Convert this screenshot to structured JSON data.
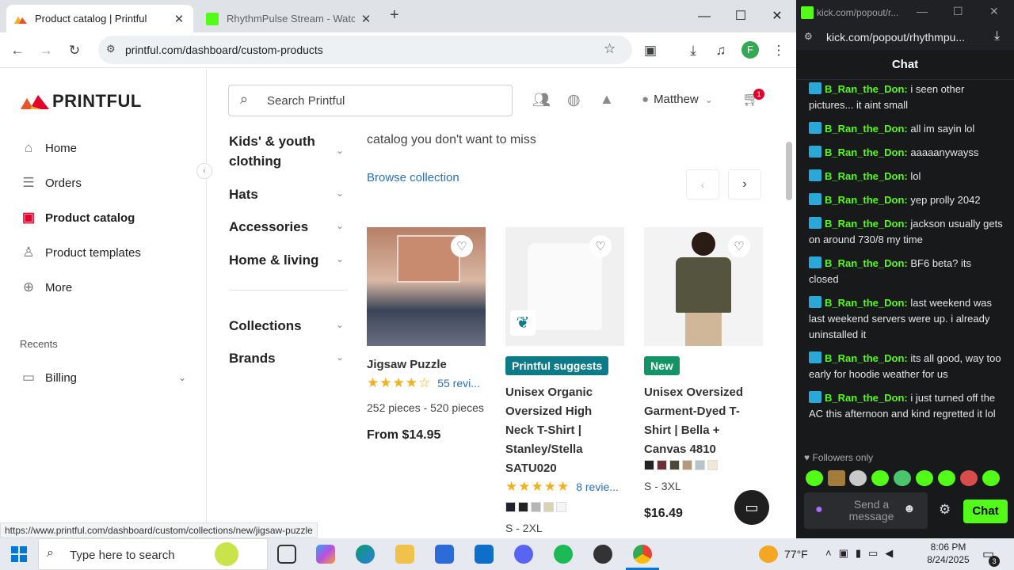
{
  "browser": {
    "tabs": [
      {
        "title": "Product catalog | Printful",
        "active": true
      },
      {
        "title": "RhythmPulse Stream - Watch Li",
        "active": false
      }
    ],
    "new_tab_glyph": "+",
    "address": "printful.com/dashboard/custom-products",
    "profile_initial": "F",
    "status_url": "https://www.printful.com/dashboard/custom/collections/new/jigsaw-puzzle"
  },
  "printful": {
    "brand": "PRINTFUL",
    "nav": [
      {
        "label": "Home",
        "icon": "home-icon"
      },
      {
        "label": "Orders",
        "icon": "list-icon"
      },
      {
        "label": "Product catalog",
        "icon": "bag-icon",
        "active": true
      },
      {
        "label": "Product templates",
        "icon": "shirt-icon"
      },
      {
        "label": "More",
        "icon": "plus-circle-icon"
      }
    ],
    "recents_label": "Recents",
    "recents": [
      {
        "label": "Billing",
        "icon": "card-icon"
      }
    ],
    "search_placeholder": "Search Printful",
    "user_name": "Matthew",
    "cart_count": "1",
    "categories": [
      "Kids' & youth clothing",
      "Hats",
      "Accessories",
      "Home & living",
      "Collections",
      "Brands"
    ],
    "collection_text": "catalog you don't want to miss",
    "browse_link": "Browse collection",
    "products": [
      {
        "name": "Jigsaw Puzzle",
        "rating": 4,
        "reviews": "55 revi...",
        "detail": "252 pieces - 520 pieces",
        "price": "From $14.95"
      },
      {
        "badge": "Printful suggests",
        "name": "Unisex Organic Oversized High Neck T-Shirt | Stanley/Stella SATU020",
        "rating": 5,
        "reviews": "8 revie...",
        "swatches": [
          "#1c2230",
          "#222222",
          "#b5b5b5",
          "#d9d3b0",
          "#f5f5f5"
        ],
        "detail": "S - 2XL"
      },
      {
        "badge": "New",
        "name": "Unisex Oversized Garment-Dyed T-Shirt | Bella + Canvas 4810",
        "swatches": [
          "#222222",
          "#6b2f36",
          "#4a4a3a",
          "#b49a7a",
          "#b9c3c9",
          "#efe9d9"
        ],
        "detail": "S - 3XL",
        "price": "$16.49"
      }
    ]
  },
  "kick": {
    "window_url": "kick.com/popout/r...",
    "address": "kick.com/popout/rhythmpu...",
    "chat_title": "Chat",
    "messages": [
      {
        "user": "B_Ran_the_Don",
        "text": "i seen other pictures... it aint small"
      },
      {
        "user": "B_Ran_the_Don",
        "text": "all im sayin lol"
      },
      {
        "user": "B_Ran_the_Don",
        "text": "aaaaanywayss"
      },
      {
        "user": "B_Ran_the_Don",
        "text": "lol"
      },
      {
        "user": "B_Ran_the_Don",
        "text": "yep prolly 2042"
      },
      {
        "user": "B_Ran_the_Don",
        "text": "jackson usually gets on around 730/8 my time"
      },
      {
        "user": "B_Ran_the_Don",
        "text": "BF6 beta? its closed"
      },
      {
        "user": "B_Ran_the_Don",
        "text": "last weekend was last weekend servers were up. i already uninstalled it"
      },
      {
        "user": "B_Ran_the_Don",
        "text": "its all good, way too early for hoodie weather for us"
      },
      {
        "user": "B_Ran_the_Don",
        "text": "i just turned off the AC this afternoon and kind regretted it lol"
      }
    ],
    "followers_only": "Followers only",
    "input_placeholder": "Send a message",
    "send_label": "Chat"
  },
  "taskbar": {
    "search_placeholder": "Type here to search",
    "weather": "77°F",
    "time": "8:06 PM",
    "date": "8/24/2025",
    "notifications": "3"
  },
  "colors": {
    "kick_green": "#53fc18",
    "printful_red": "#e4002b",
    "teal": "#0d7a88"
  }
}
